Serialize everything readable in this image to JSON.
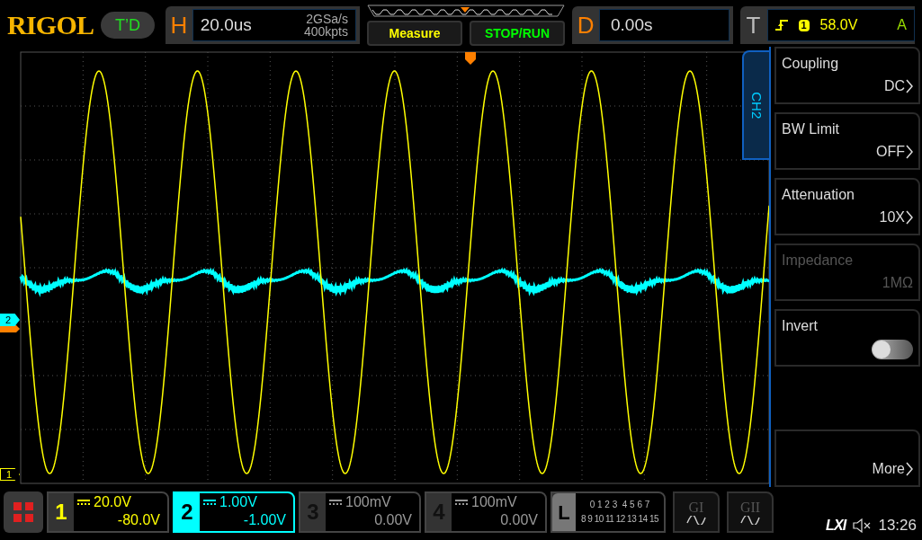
{
  "brand": "RIGOL",
  "mode_badge": "T’D",
  "horizontal": {
    "label": "H",
    "timebase": "20.0us",
    "sample_rate": "2GSa/s",
    "memory_depth": "400kpts"
  },
  "buttons": [
    {
      "label": "Measure",
      "color": "#ffff00"
    },
    {
      "label": "STOP/RUN",
      "color": "#00ff00"
    }
  ],
  "delay": {
    "label": "D",
    "value": "0.00s"
  },
  "trigger": {
    "label": "T",
    "source": "1",
    "level": "58.0V",
    "mode": "A"
  },
  "markers": [
    {
      "label": "2",
      "color": "#00ffff"
    },
    {
      "label": "1",
      "color": "#ffff00"
    }
  ],
  "side_menu": {
    "tab": "CH2",
    "items": [
      {
        "kind": "select",
        "label": "Coupling",
        "value": "DC",
        "disabled": false
      },
      {
        "kind": "select",
        "label": "BW Limit",
        "value": "OFF",
        "disabled": false
      },
      {
        "kind": "select",
        "label": "Attenuation",
        "value": "10X",
        "disabled": false
      },
      {
        "kind": "select",
        "label": "Impedance",
        "value": "1MΩ",
        "disabled": true
      },
      {
        "kind": "toggle",
        "label": "Invert",
        "on": false,
        "disabled": false
      },
      {
        "kind": "select",
        "label": "More",
        "disabled": false
      }
    ]
  },
  "channels": [
    {
      "label": "1",
      "scale": "20.0V",
      "offset": "-80.0V",
      "enabled": true,
      "selected": false,
      "color": "#ffff00"
    },
    {
      "label": "2",
      "scale": "1.00V",
      "offset": "-1.00V",
      "enabled": true,
      "selected": true,
      "color": "#00ffff"
    },
    {
      "label": "3",
      "scale": "100mV",
      "offset": "0.00V",
      "enabled": false,
      "selected": false
    },
    {
      "label": "4",
      "scale": "100mV",
      "offset": "0.00V",
      "enabled": false,
      "selected": false
    }
  ],
  "logic": {
    "label": "L",
    "row_1": "0 1 2 3  4 5 6 7",
    "row_2": "8 9 10 11 12 13 14 15"
  },
  "generators": [
    {
      "label": "GI"
    },
    {
      "label": "GII"
    }
  ],
  "status": {
    "lxi": "LXI",
    "time": "13:26"
  }
}
